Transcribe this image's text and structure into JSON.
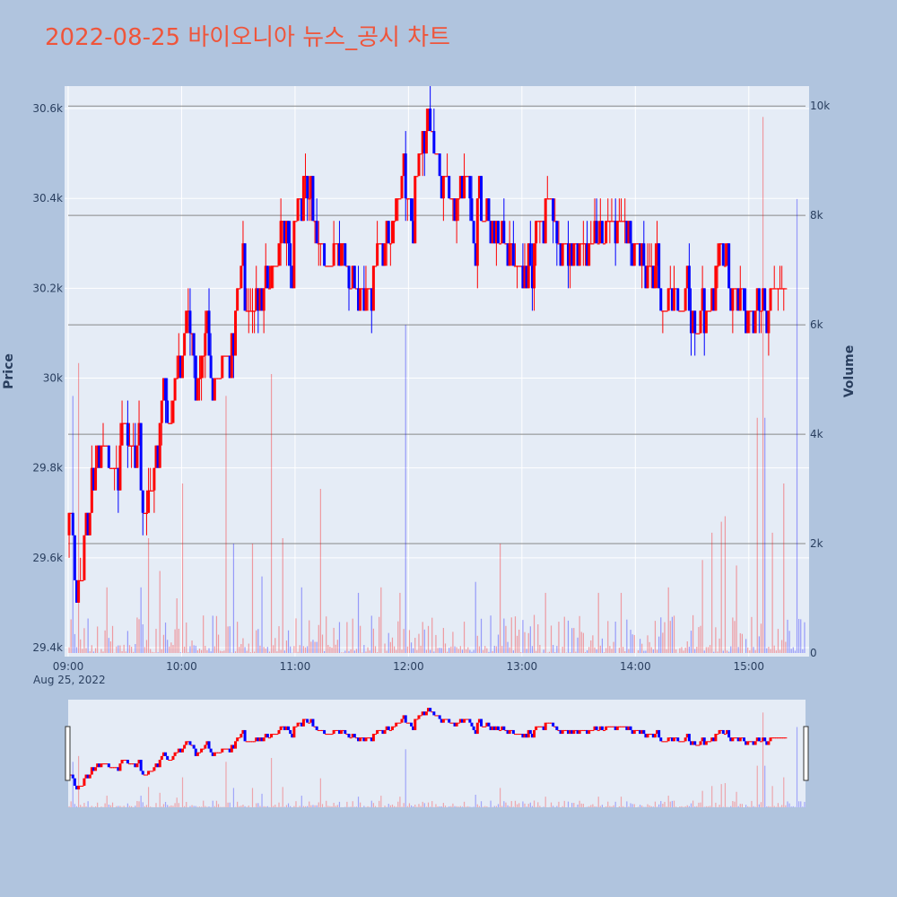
{
  "chart_data": {
    "type": "candlestick",
    "title": "2022-08-25 바이오니아 뉴스_공시 차트",
    "ylabel": "Price",
    "y2label": "Volume",
    "x_tick_labels": [
      "09:00",
      "10:00",
      "11:00",
      "12:00",
      "13:00",
      "14:00",
      "15:00"
    ],
    "x_date_label": "Aug 25, 2022",
    "x_range": [
      "09:00",
      "15:30"
    ],
    "y_range": [
      29380,
      30650
    ],
    "y_tick_labels": [
      "29.4k",
      "29.6k",
      "29.8k",
      "30k",
      "30.2k",
      "30.4k",
      "30.6k"
    ],
    "y2_range": [
      0,
      10200
    ],
    "y2_tick_labels": [
      "0",
      "2k",
      "4k",
      "6k",
      "8k",
      "10k"
    ],
    "colors": {
      "up": "#ff0000",
      "down": "#0000ff",
      "paper_bg": "#b0c4de",
      "plot_bg": "#e5ecf6",
      "title": "#ef553b"
    },
    "price_anchors": [
      [
        "09:00",
        29650
      ],
      [
        "09:02",
        29700
      ],
      [
        "09:05",
        29500
      ],
      [
        "09:08",
        29550
      ],
      [
        "09:12",
        29850
      ],
      [
        "09:15",
        29700
      ],
      [
        "09:18",
        29850
      ],
      [
        "09:25",
        29800
      ],
      [
        "09:30",
        29900
      ],
      [
        "09:35",
        29850
      ],
      [
        "09:40",
        29700
      ],
      [
        "09:45",
        29750
      ],
      [
        "09:50",
        29950
      ],
      [
        "09:55",
        29900
      ],
      [
        "10:00",
        30100
      ],
      [
        "10:05",
        30150
      ],
      [
        "10:08",
        29950
      ],
      [
        "10:12",
        30050
      ],
      [
        "10:18",
        30000
      ],
      [
        "10:25",
        30050
      ],
      [
        "10:30",
        30200
      ],
      [
        "10:35",
        30150
      ],
      [
        "10:40",
        30120
      ],
      [
        "10:45",
        30200
      ],
      [
        "10:50",
        30250
      ],
      [
        "10:55",
        30350
      ],
      [
        "11:00",
        30350
      ],
      [
        "11:05",
        30450
      ],
      [
        "11:08",
        30400
      ],
      [
        "11:12",
        30300
      ],
      [
        "11:18",
        30250
      ],
      [
        "11:25",
        30300
      ],
      [
        "11:30",
        30200
      ],
      [
        "11:35",
        30200
      ],
      [
        "11:40",
        30220
      ],
      [
        "11:45",
        30300
      ],
      [
        "11:50",
        30300
      ],
      [
        "11:55",
        30400
      ],
      [
        "12:00",
        30380
      ],
      [
        "12:05",
        30450
      ],
      [
        "12:10",
        30600
      ],
      [
        "12:15",
        30500
      ],
      [
        "12:18",
        30450
      ],
      [
        "12:25",
        30400
      ],
      [
        "12:30",
        30450
      ],
      [
        "12:35",
        30400
      ],
      [
        "12:40",
        30350
      ],
      [
        "12:50",
        30300
      ],
      [
        "13:00",
        30250
      ],
      [
        "13:05",
        30300
      ],
      [
        "13:10",
        30350
      ],
      [
        "13:15",
        30400
      ],
      [
        "13:20",
        30300
      ],
      [
        "13:30",
        30300
      ],
      [
        "13:40",
        30300
      ],
      [
        "13:50",
        30350
      ],
      [
        "14:00",
        30300
      ],
      [
        "14:05",
        30250
      ],
      [
        "14:10",
        30250
      ],
      [
        "14:15",
        30150
      ],
      [
        "14:20",
        30200
      ],
      [
        "14:25",
        30150
      ],
      [
        "14:30",
        30150
      ],
      [
        "14:35",
        30100
      ],
      [
        "14:40",
        30150
      ],
      [
        "14:45",
        30300
      ],
      [
        "14:50",
        30200
      ],
      [
        "14:55",
        30200
      ],
      [
        "15:00",
        30150
      ],
      [
        "15:05",
        30150
      ],
      [
        "15:10",
        30200
      ],
      [
        "15:15",
        30200
      ],
      [
        "15:20",
        30200
      ]
    ],
    "volume_spikes": [
      [
        "09:02",
        4700
      ],
      [
        "09:05",
        5300
      ],
      [
        "09:20",
        1200
      ],
      [
        "09:38",
        1200
      ],
      [
        "09:42",
        2100
      ],
      [
        "09:48",
        1500
      ],
      [
        "09:57",
        1000
      ],
      [
        "10:00",
        3100
      ],
      [
        "10:23",
        4700
      ],
      [
        "10:27",
        2000
      ],
      [
        "10:37",
        2000
      ],
      [
        "10:42",
        1400
      ],
      [
        "10:47",
        5100
      ],
      [
        "10:53",
        2100
      ],
      [
        "11:03",
        1200
      ],
      [
        "11:13",
        3000
      ],
      [
        "11:33",
        1100
      ],
      [
        "11:45",
        1200
      ],
      [
        "11:55",
        1100
      ],
      [
        "11:58",
        6000
      ],
      [
        "12:35",
        1300
      ],
      [
        "12:48",
        2000
      ],
      [
        "13:12",
        1100
      ],
      [
        "13:40",
        1100
      ],
      [
        "13:52",
        1100
      ],
      [
        "14:17",
        1200
      ],
      [
        "14:35",
        1700
      ],
      [
        "14:40",
        2200
      ],
      [
        "14:45",
        2400
      ],
      [
        "14:47",
        2500
      ],
      [
        "14:53",
        1600
      ],
      [
        "15:04",
        4300
      ],
      [
        "15:07",
        9800
      ],
      [
        "15:08",
        4300
      ],
      [
        "15:12",
        2200
      ],
      [
        "15:18",
        3100
      ],
      [
        "15:25",
        8300
      ]
    ]
  }
}
